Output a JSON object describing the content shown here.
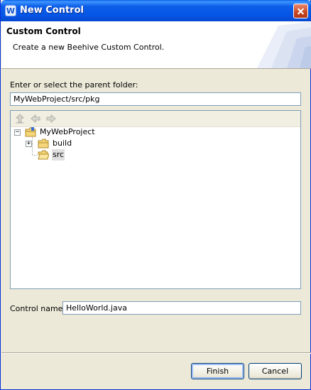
{
  "window": {
    "title": "New Control",
    "app_icon_glyph": "W"
  },
  "banner": {
    "title": "Custom Control",
    "description": "Create a new Beehive Custom Control."
  },
  "parent_folder": {
    "label": "Enter or select the parent folder:",
    "value": "MyWebProject/src/pkg"
  },
  "tree": {
    "toolbar": [
      {
        "name": "up-folder-icon"
      },
      {
        "name": "back-arrow-icon"
      },
      {
        "name": "forward-arrow-icon"
      }
    ],
    "items": [
      {
        "label": "MyWebProject",
        "expander": "−"
      },
      {
        "label": "build",
        "expander": "+"
      },
      {
        "label": "src",
        "selected": true
      }
    ]
  },
  "control_name": {
    "label": "Control name:",
    "value": "HelloWorld.java"
  },
  "buttons": {
    "finish": "Finish",
    "cancel": "Cancel"
  }
}
